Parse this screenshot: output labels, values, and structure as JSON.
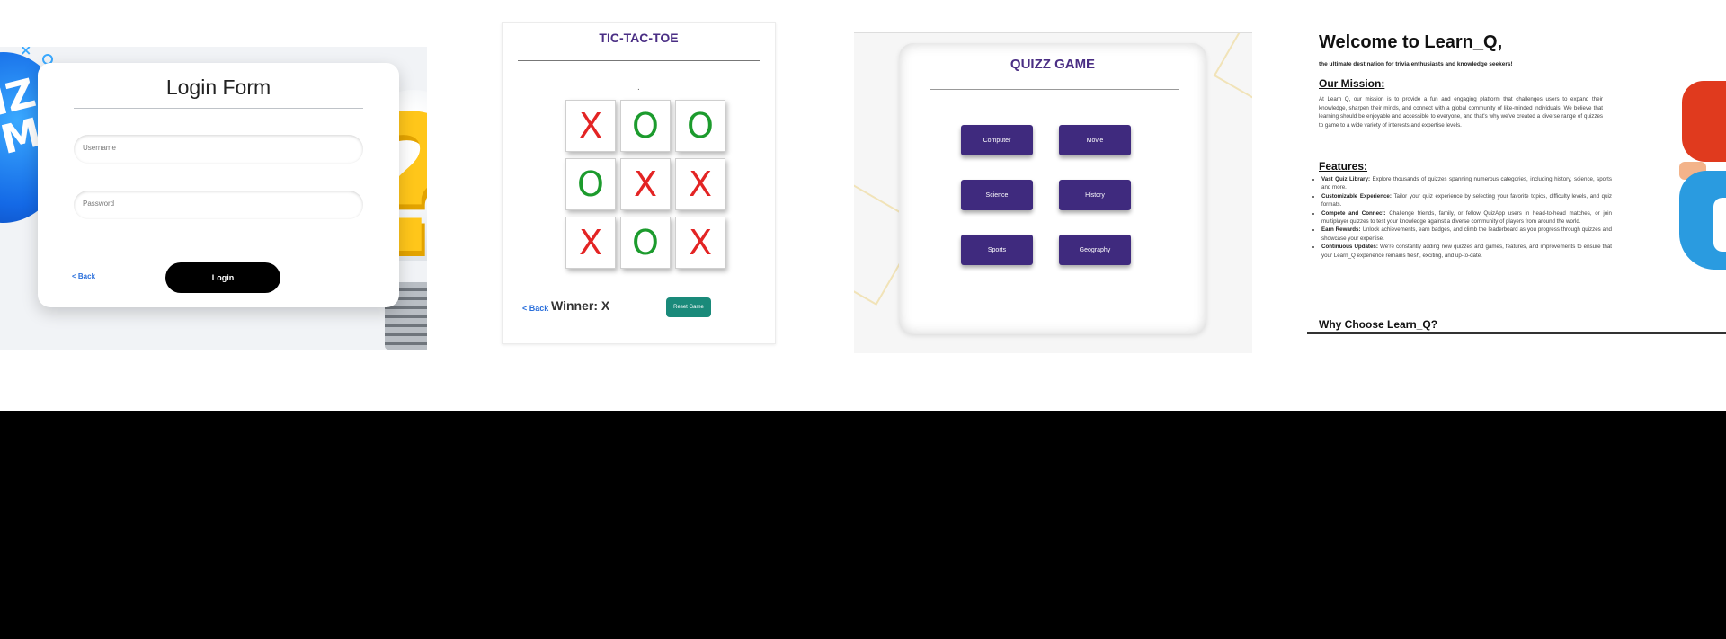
{
  "login": {
    "badge_text": "IZ\nME",
    "title": "Login Form",
    "username_placeholder": "Username",
    "password_placeholder": "Password",
    "back_label": "< Back",
    "login_label": "Login"
  },
  "tictactoe": {
    "title": "TIC-TAC-TOE",
    "status_dot": ".",
    "board": [
      "X",
      "O",
      "O",
      "O",
      "X",
      "X",
      "X",
      "O",
      "X"
    ],
    "back_label": "< Back",
    "winner_text": "Winner: X",
    "reset_label": "Reset Game",
    "colors": {
      "x": "#e32424",
      "o": "#1c9b2d"
    }
  },
  "quiz": {
    "title": "QUIZZ GAME",
    "categories": [
      "Computer",
      "Movie",
      "Science",
      "History",
      "Sports",
      "Geography"
    ],
    "button_color": "#3f2a7e"
  },
  "welcome": {
    "heading": "Welcome to Learn_Q,",
    "subheading": "the ultimate destination for trivia enthusiasts and knowledge seekers!",
    "mission_heading": "Our Mission:",
    "mission_text": "At Learn_Q, our mission is to provide a fun and engaging platform that challenges users to expand their knowledge, sharpen their minds, and connect with a global community of like-minded individuals. We believe that learning should be enjoyable and accessible to everyone, and that's why we've created a diverse range of quizzes to game to a wide variety of interests and expertise levels.",
    "features_heading": "Features:",
    "features": [
      {
        "name": "Vast Quiz Library:",
        "text": "Explore thousands of quizzes spanning numerous categories, including history, science, sports and more."
      },
      {
        "name": "Customizable Experience:",
        "text": "Tailor your quiz experience by selecting your favorite topics, difficulty levels, and quiz formats."
      },
      {
        "name": "Compete and Connect:",
        "text": "Challenge friends, family, or fellow QuizApp users in head-to-head matches, or join multiplayer quizzes to test your knowledge against a diverse community of players from around the world."
      },
      {
        "name": "Earn Rewards:",
        "text": "Unlock achievements, earn badges, and climb the leaderboard as you progress through quizzes and showcase your expertise."
      },
      {
        "name": "Continuous Updates:",
        "text": "We're constantly adding new quizzes and games, features, and improvements to ensure that your Learn_Q experience remains fresh, exciting, and up-to-date."
      }
    ],
    "why_heading": "Why Choose Learn_Q?"
  }
}
